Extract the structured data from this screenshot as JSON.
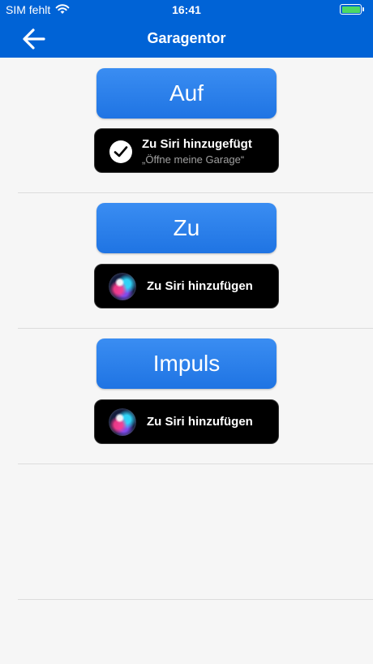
{
  "status_bar": {
    "carrier": "SIM fehlt",
    "time": "16:41"
  },
  "nav": {
    "title": "Garagentor",
    "back_icon": "arrow-left-icon"
  },
  "sections": [
    {
      "action_label": "Auf",
      "siri_state": "added",
      "siri_title": "Zu Siri hinzugefügt",
      "siri_phrase": "„Öffne meine Garage“"
    },
    {
      "action_label": "Zu",
      "siri_state": "not_added",
      "siri_title": "Zu Siri hinzufügen"
    },
    {
      "action_label": "Impuls",
      "siri_state": "not_added",
      "siri_title": "Zu Siri hinzufügen"
    }
  ],
  "colors": {
    "nav_bg": "#0063d6",
    "button_blue": "#2a7fea",
    "battery": "#4cd964"
  }
}
